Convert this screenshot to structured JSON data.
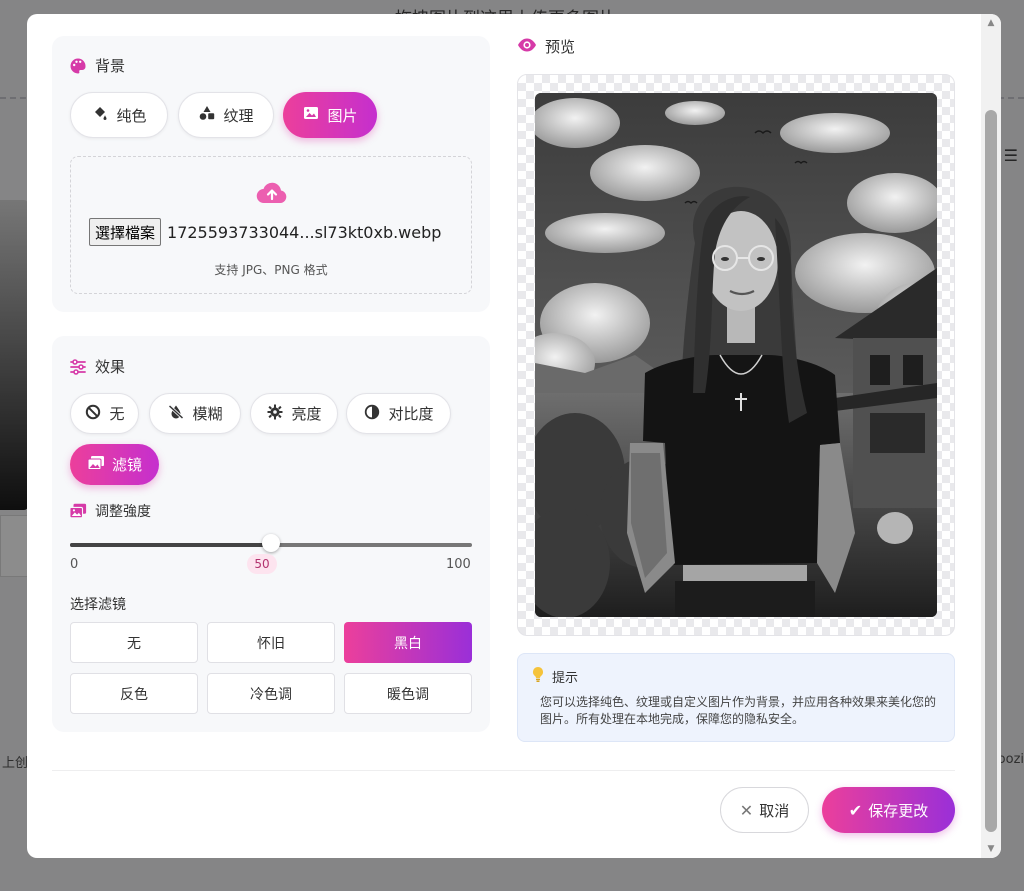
{
  "background_page": {
    "title": "拖拽图片到这里上传更多图片",
    "left_text": "上创作",
    "right_text": "oozi"
  },
  "background_section": {
    "title": "背景",
    "title_icon": "palette-icon",
    "tabs": [
      {
        "label": "纯色",
        "icon": "paint-bucket-icon",
        "active": false
      },
      {
        "label": "纹理",
        "icon": "shapes-icon",
        "active": false
      },
      {
        "label": "图片",
        "icon": "image-icon",
        "active": true
      }
    ],
    "upload": {
      "icon": "cloud-upload-icon",
      "file_button": "選擇檔案",
      "file_name": "1725593733044...sl73kt0xb.webp",
      "hint": "支持 JPG、PNG 格式"
    }
  },
  "effects_section": {
    "title": "效果",
    "title_icon": "sliders-icon",
    "tabs": [
      {
        "label": "无",
        "icon": "ban-icon",
        "active": false
      },
      {
        "label": "模糊",
        "icon": "droplet-slash-icon",
        "active": false
      },
      {
        "label": "亮度",
        "icon": "gear-icon",
        "active": false
      },
      {
        "label": "对比度",
        "icon": "contrast-icon",
        "active": false
      },
      {
        "label": "滤镜",
        "icon": "images-icon",
        "active": true
      }
    ],
    "intensity": {
      "label": "调整強度",
      "icon": "images-icon",
      "value": 50,
      "min": 0,
      "max": 100,
      "value_label": "50",
      "min_label": "0",
      "max_label": "100"
    },
    "filter_select": {
      "label": "选择滤镜",
      "options": [
        {
          "label": "无",
          "active": false
        },
        {
          "label": "怀旧",
          "active": false
        },
        {
          "label": "黑白",
          "active": true
        },
        {
          "label": "反色",
          "active": false
        },
        {
          "label": "冷色调",
          "active": false
        },
        {
          "label": "暖色调",
          "active": false
        }
      ]
    }
  },
  "preview": {
    "title": "预览",
    "icon": "eye-icon"
  },
  "tip": {
    "title": "提示",
    "icon": "lightbulb-icon",
    "text": "您可以选择纯色、纹理或自定义图片作为背景，并应用各种效果来美化您的图片。所有处理在本地完成，保障您的隐私安全。"
  },
  "footer": {
    "cancel_label": "取消",
    "save_label": "保存更改"
  },
  "colors": {
    "accent_start": "#ec3f9b",
    "accent_end": "#9a2fd8",
    "icon_pink": "#d63aa8",
    "tip_bg": "#eef3fd"
  }
}
